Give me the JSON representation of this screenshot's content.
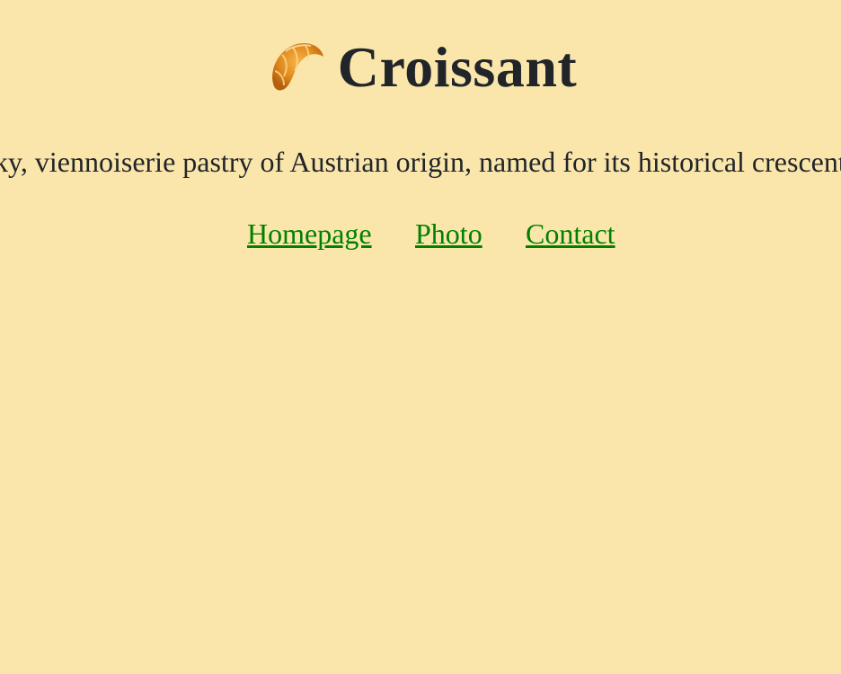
{
  "header": {
    "title": "Croissant",
    "icon": "croissant-icon"
  },
  "marquee": {
    "text": "A croissant is a buttery, flaky, viennoiserie pastry of Austrian origin, named for its historical crescent shape. Croissants and other viennoiserie are made of a layered yeast-leavened dough."
  },
  "nav": {
    "items": [
      {
        "label": "Homepage"
      },
      {
        "label": "Photo"
      },
      {
        "label": "Contact"
      }
    ],
    "link_color": "#008000"
  },
  "colors": {
    "background": "#fae6ab",
    "text": "#212529"
  }
}
